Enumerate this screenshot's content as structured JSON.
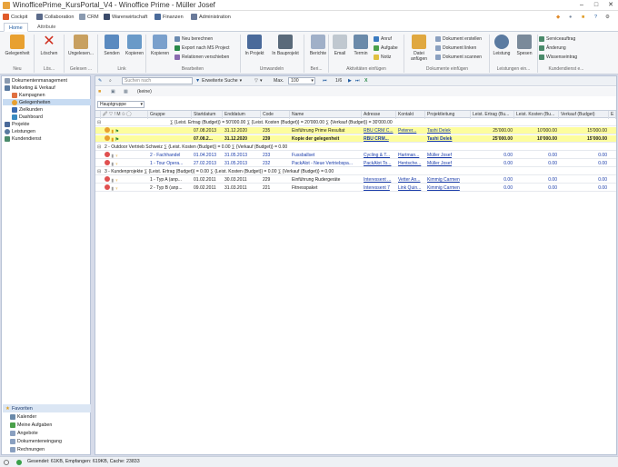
{
  "window": {
    "title": "WinofficePrime_KursPortal_V4 - Winoffice Prime - Müller Josef"
  },
  "quickbar": {
    "items": [
      {
        "label": "Cockpit",
        "icon": "cockpit-icon"
      },
      {
        "label": "Collaboration",
        "icon": "collaboration-icon"
      },
      {
        "label": "CRM",
        "icon": "crm-icon"
      },
      {
        "label": "Warenwirtschaft",
        "icon": "warenwirtschaft-icon"
      },
      {
        "label": "Finanzen",
        "icon": "finanzen-icon"
      },
      {
        "label": "Administration",
        "icon": "administration-icon"
      }
    ]
  },
  "tabs": [
    {
      "label": "Home"
    },
    {
      "label": "Attribute"
    }
  ],
  "ribbon": {
    "buttons": {
      "gelegenheit": "Gelegenheit",
      "loeschen": "Löschen",
      "ungelesen": "Ungelesen...",
      "senden": "Senden",
      "kopieren": "Kopieren",
      "kopieren2": "Kopieren",
      "neu_berechnen": "Neu berechnen",
      "export_ms": "Export nach MS Project",
      "relationen": "Relationen verschieben",
      "in_projekt": "In Projekt",
      "in_bauprojekt": "In Bauprojekt",
      "berichte": "Berichte",
      "email": "Email",
      "termin": "Termin",
      "anruf": "Anruf",
      "aufgabe": "Aufgabe",
      "notiz": "Notiz",
      "datei_anfuegen": "Datei anfügen",
      "dok_erstellen": "Dokument erstellen",
      "dok_linken": "Dokument linken",
      "dok_scannen": "Dokument scannen",
      "leistung": "Leistung",
      "spesen": "Spesen",
      "serviceauftrag": "Serviceauftrag",
      "aenderung": "Änderung",
      "wissenseintrag": "Wissenseintrag"
    },
    "groups": [
      "Neu",
      "Lös...",
      "Gelesen ...",
      "Link",
      "Bearbeiten",
      "Umwandeln",
      "Beri...",
      "Aktivitäten einfügen",
      "Dokumente einfügen",
      "Leistungen ein...",
      "Kundendienst e..."
    ]
  },
  "nav": {
    "items": [
      {
        "label": "Dokumentenmanagement",
        "indent": 0,
        "selected": false
      },
      {
        "label": "Marketing & Verkauf",
        "indent": 0,
        "selected": false
      },
      {
        "label": "Kampagnen",
        "indent": 1,
        "selected": false
      },
      {
        "label": "Gelegenheiten",
        "indent": 1,
        "selected": true
      },
      {
        "label": "Zielkunden",
        "indent": 1,
        "selected": false
      },
      {
        "label": "Dashboard",
        "indent": 1,
        "selected": false
      },
      {
        "label": "Projekte",
        "indent": 0,
        "selected": false
      },
      {
        "label": "Leistungen",
        "indent": 0,
        "selected": false
      },
      {
        "label": "Kundendienst",
        "indent": 0,
        "selected": false
      }
    ],
    "favorites_title": "Favoriten",
    "favorites": [
      "Kalender",
      "Meine Aufgaben",
      "Angebote",
      "Dokumenteneingang",
      "Rechnungen"
    ]
  },
  "search": {
    "placeholder": "Suchen nach",
    "extended": "Erweiterte Suche",
    "max_label": "Max.",
    "max_value": "100",
    "pager": "1/6",
    "filter_value": "(keine)",
    "group_field": "Hauptgruppe"
  },
  "grid": {
    "columns": [
      "Gruppe",
      "Startdatum",
      "Enddatum",
      "Code",
      "Name",
      "Adresse",
      "Kontakt",
      "Projektleitung",
      "Leist. Ertrag (Bu...",
      "Leist. Kosten (Bu...",
      "Verkauf (Budget)",
      "E"
    ],
    "rows": [
      {
        "type": "summary",
        "text": "∑ {Leist. Ertrag (Budget)} = 50'000.00   ∑ {Leist. Kosten (Budget)} = 20'000.00   ∑ {Verkauf (Budget)} = 30'000.00"
      },
      {
        "type": "data",
        "style": "hl",
        "gruppe": "",
        "start": "07.08.2013",
        "ende": "31.12.2020",
        "code": "235",
        "name": "Einführung Prime Resultat",
        "adresse": "RBU CRM C...",
        "kontakt": "Peterer...",
        "pl": "Tashi Delek",
        "ertrag": "25'000.00",
        "kosten": "10'000.00",
        "verkauf": "15'000.00"
      },
      {
        "type": "data",
        "style": "hl2",
        "gruppe": "",
        "start": "07.08.2...",
        "ende": "31.12.2020",
        "code": "239",
        "name": "Kopie der gelegenheit",
        "adresse": "RBU CRM...",
        "kontakt": "",
        "pl": "Tashi Delek",
        "ertrag": "25'000.00",
        "kosten": "10'000.00",
        "verkauf": "15'000.00"
      },
      {
        "type": "group",
        "text": "2 - Outdoor Vertrieb Schweiz   ∑ {Leist. Kosten (Budget)} = 0.00   ∑ {Verkauf (Budget)} = 0.00"
      },
      {
        "type": "data",
        "style": "",
        "gruppe": "2 - Fachhandel",
        "start": "01.04.2013",
        "ende": "31.05.2013",
        "code": "233",
        "name": "Fussballset",
        "adresse": "Cycling & T...",
        "kontakt": "Hartman...",
        "pl": "Müller Josef",
        "ertrag": "0.00",
        "kosten": "0.00",
        "verkauf": "0.00"
      },
      {
        "type": "data",
        "style": "",
        "gruppe": "1 - Tour Opera...",
        "start": "27.02.2013",
        "ende": "31.05.2013",
        "code": "232",
        "name": "PackAlot - Neue Vertriebspa...",
        "adresse": "PackAlot To...",
        "kontakt": "Hentsche...",
        "pl": "Müller Josef",
        "ertrag": "0.00",
        "kosten": "0.00",
        "verkauf": "0.00"
      },
      {
        "type": "group",
        "text": "3 - Kundenprojekte   ∑ {Leist. Ertrag (Budget)} = 0.00   ∑ {Leist. Kosten (Budget)} = 0.00   ∑ {Verkauf (Budget)} = 0.00"
      },
      {
        "type": "data",
        "style": "",
        "gruppe": "1 - Typ A (anp...",
        "start": "01.02.2011",
        "ende": "30.03.2011",
        "code": "229",
        "name": "Einführung Rudergeräte",
        "adresse": "Interessent ...",
        "kontakt": "Vetter An...",
        "pl": "Kimmig Carmen",
        "ertrag": "0.00",
        "kosten": "0.00",
        "verkauf": "0.00"
      },
      {
        "type": "data",
        "style": "",
        "gruppe": "2 - Typ B (anp...",
        "start": "09.02.2011",
        "ende": "31.03.2011",
        "code": "221",
        "name": "Fitnesspaket",
        "adresse": "Interessent 7",
        "kontakt": "Link Quin...",
        "pl": "Kimmig Carmen",
        "ertrag": "0.00",
        "kosten": "0.00",
        "verkauf": "0.00"
      }
    ]
  },
  "status": {
    "text": "Gesendet: 61KB, Empfangen: 619KB, Cache: 23833"
  },
  "colors": {
    "accent": "#1e5aa0",
    "highlight": "#fdfd9e",
    "link": "#1a3caa"
  }
}
